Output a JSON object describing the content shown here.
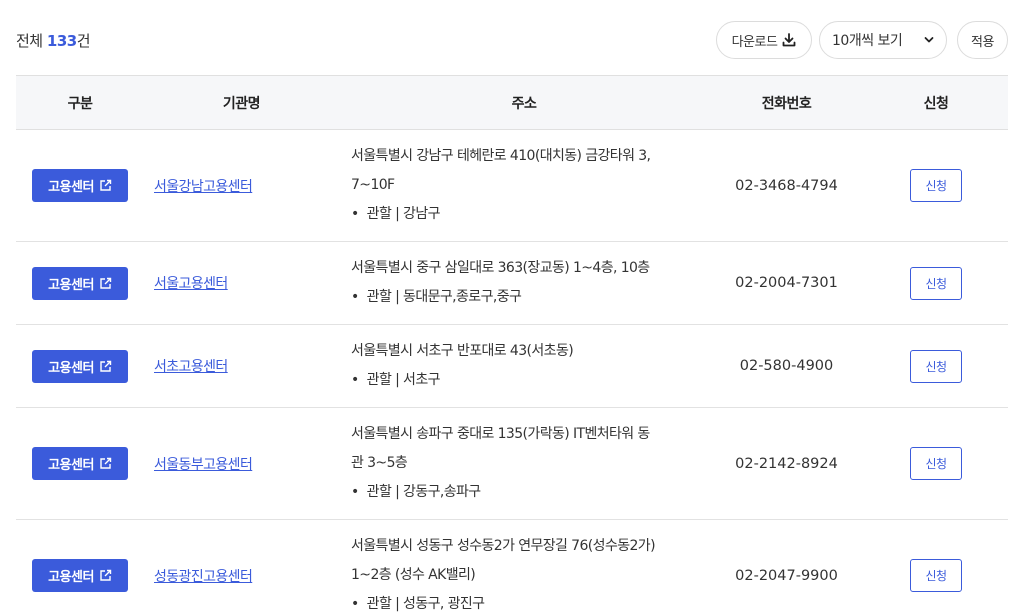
{
  "header": {
    "total_prefix": "전체",
    "total_count": "133",
    "total_suffix": "건",
    "download_label": "다운로드",
    "per_page_selected": "10개씩 보기",
    "apply_label": "적용"
  },
  "table": {
    "columns": [
      "구분",
      "기관명",
      "주소",
      "전화번호",
      "신청"
    ],
    "rows": [
      {
        "type": "고용센터",
        "name": "서울강남고용센터",
        "address_lines": [
          "서울특별시 강남구 테헤란로 410(대치동) 금강타워 3,",
          "7~10F"
        ],
        "jurisdiction": "관할 | 강남구",
        "phone": "02-3468-4794",
        "apply": "신청"
      },
      {
        "type": "고용센터",
        "name": "서울고용센터",
        "address_lines": [
          "서울특별시 중구 삼일대로 363(장교동) 1~4층, 10층"
        ],
        "jurisdiction": "관할 | 동대문구,종로구,중구",
        "phone": "02-2004-7301",
        "apply": "신청"
      },
      {
        "type": "고용센터",
        "name": "서초고용센터",
        "address_lines": [
          "서울특별시 서초구 반포대로 43(서초동)"
        ],
        "jurisdiction": "관할 | 서초구",
        "phone": "02-580-4900",
        "apply": "신청"
      },
      {
        "type": "고용센터",
        "name": "서울동부고용센터",
        "address_lines": [
          "서울특별시 송파구 중대로 135(가락동) IT벤처타워 동",
          "관 3~5층"
        ],
        "jurisdiction": "관할 | 강동구,송파구",
        "phone": "02-2142-8924",
        "apply": "신청"
      },
      {
        "type": "고용센터",
        "name": "성동광진고용센터",
        "address_lines": [
          "서울특별시 성동구 성수동2가 연무장길 76(성수동2가)",
          "1~2층 (성수 AK밸리)"
        ],
        "jurisdiction": "관할 | 성동구, 광진구",
        "phone": "02-2047-9900",
        "apply": "신청"
      }
    ]
  },
  "icons": {
    "download": "download-icon",
    "external_link": "external-link-icon",
    "select": "chevron-down-icon"
  },
  "colors": {
    "accent": "#3b5bdb",
    "header_bg": "#f6f7f9"
  }
}
